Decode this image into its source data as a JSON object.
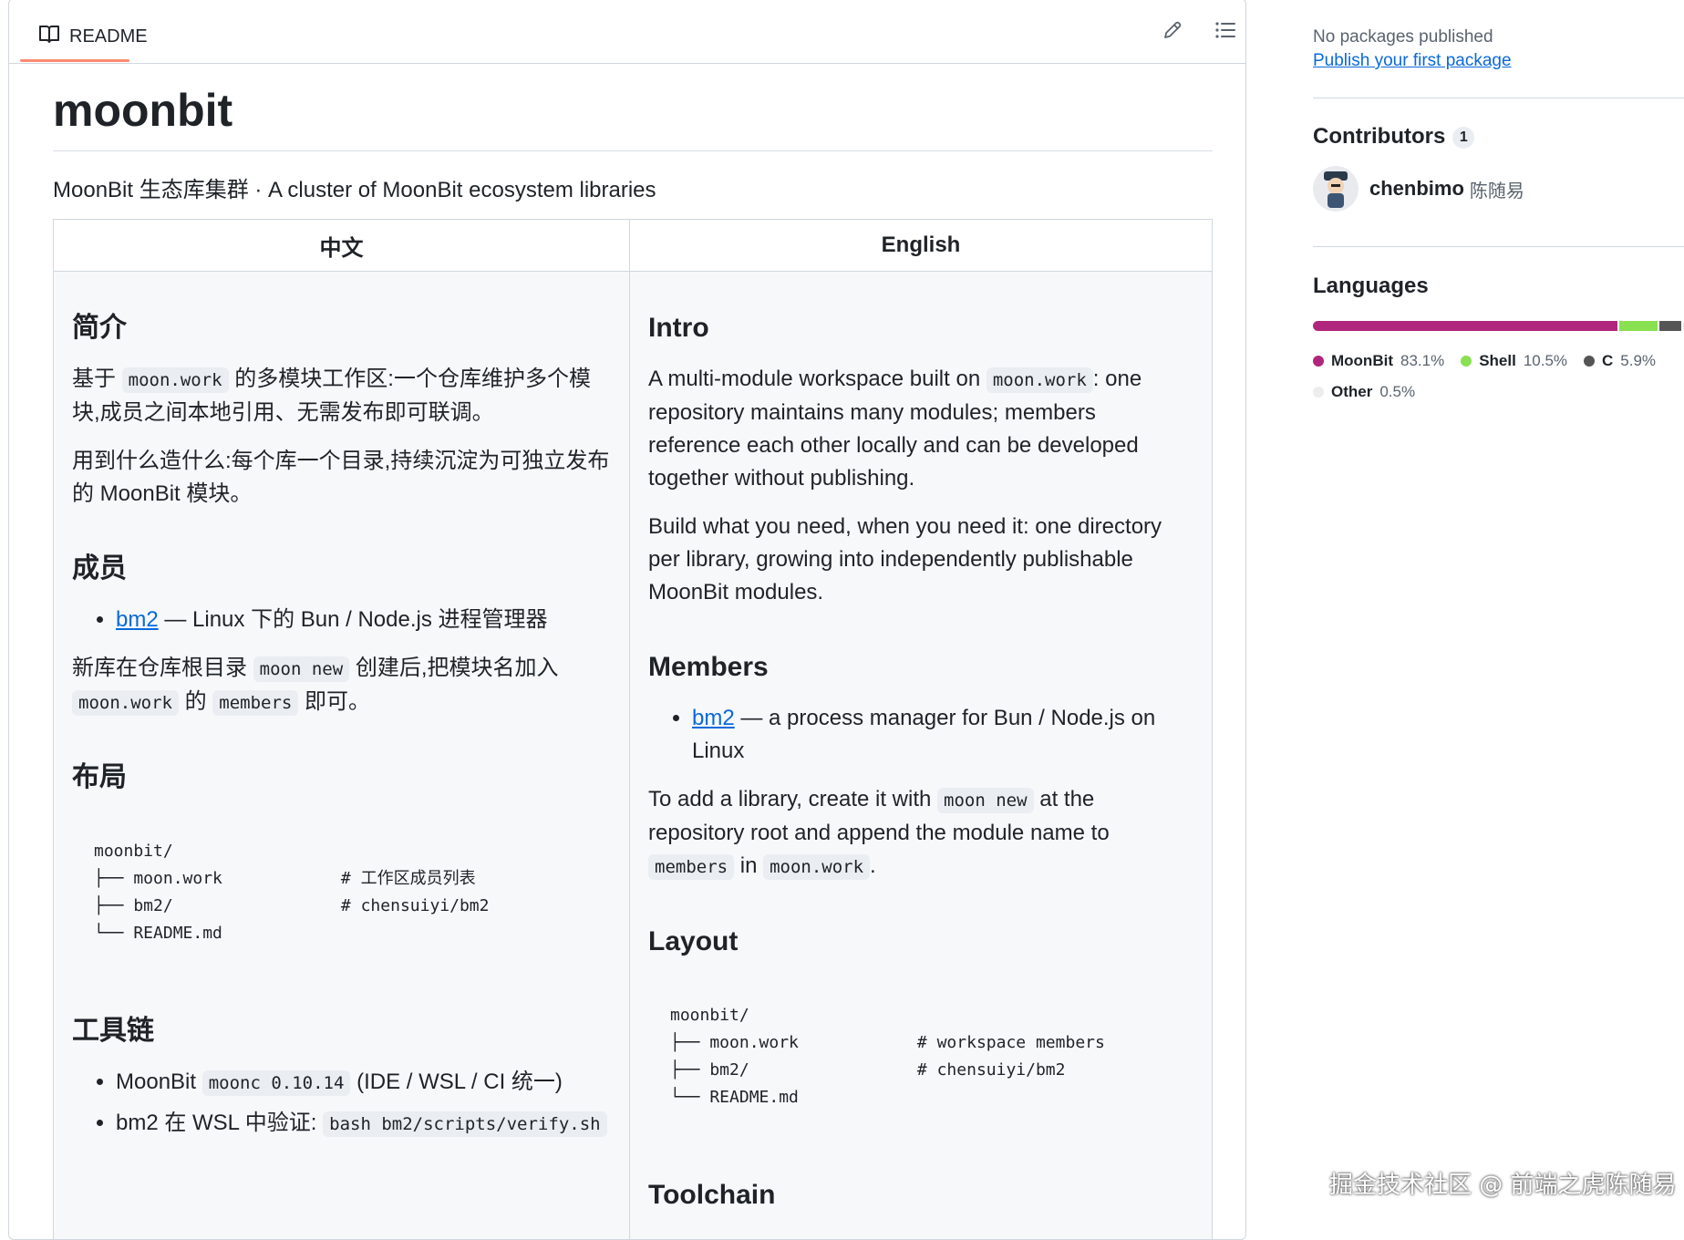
{
  "readme": {
    "tab_label": "README",
    "title": "moonbit",
    "subtitle": "MoonBit 生态库集群 · A cluster of MoonBit ecosystem libraries",
    "columns": [
      "中文",
      "English"
    ]
  },
  "zh": {
    "intro_heading": "简介",
    "intro_p1_a": "基于",
    "intro_p1_code": "moon.work",
    "intro_p1_b": "的多模块工作区:一个仓库维护多个模块,成员之间本地引用、无需发布即可联调。",
    "intro_p2": "用到什么造什么:每个库一个目录,持续沉淀为可独立发布的 MoonBit 模块。",
    "members_heading": "成员",
    "member_link": "bm2",
    "member_desc": " — Linux 下的 Bun / Node.js 进程管理器",
    "add_a": "新库在仓库根目录",
    "add_code1": "moon new",
    "add_b": "创建后,把模块名加入",
    "add_code2": "moon.work",
    "add_c": "的",
    "add_code3": "members",
    "add_d": "即可。",
    "layout_heading": "布局",
    "tree": "moonbit/\n├── moon.work            # 工作区成员列表\n├── bm2/                 # chensuiyi/bm2\n└── README.md",
    "toolchain_heading": "工具链",
    "tool1_a": "MoonBit ",
    "tool1_code": "moonc 0.10.14",
    "tool1_b": " (IDE / WSL / CI 统一)",
    "tool2_a": "bm2 在 WSL 中验证: ",
    "tool2_code": "bash bm2/scripts/verify.sh"
  },
  "en": {
    "intro_heading": "Intro",
    "intro_p1_a": "A multi-module workspace built on ",
    "intro_p1_code": "moon.work",
    "intro_p1_b": ": one repository maintains many modules; members reference each other locally and can be developed together without publishing.",
    "intro_p2": "Build what you need, when you need it: one directory per library, growing into independently publishable MoonBit modules.",
    "members_heading": "Members",
    "member_link": "bm2",
    "member_desc": " — a process manager for Bun / Node.js on Linux",
    "add_a": "To add a library, create it with ",
    "add_code1": "moon new",
    "add_b": " at the repository root and append the module name to ",
    "add_code2": "members",
    "add_c": " in ",
    "add_code3": "moon.work",
    "add_d": ".",
    "layout_heading": "Layout",
    "tree": "moonbit/\n├── moon.work            # workspace members\n├── bm2/                 # chensuiyi/bm2\n└── README.md",
    "toolchain_heading": "Toolchain"
  },
  "sidebar": {
    "packages_empty": "No packages published",
    "packages_link": "Publish your first package",
    "contributors_heading": "Contributors",
    "contributors_count": "1",
    "contributor_login": "chenbimo",
    "contributor_name": "陈随易",
    "languages_heading": "Languages",
    "languages": [
      {
        "name": "MoonBit",
        "pct": "83.1%",
        "value": 83.1,
        "color": "#b0267c"
      },
      {
        "name": "Shell",
        "pct": "10.5%",
        "value": 10.5,
        "color": "#89e051"
      },
      {
        "name": "C",
        "pct": "5.9%",
        "value": 5.9,
        "color": "#555555"
      },
      {
        "name": "Other",
        "pct": "0.5%",
        "value": 0.5,
        "color": "#ededed"
      }
    ]
  },
  "watermark": "掘金技术社区 @ 前端之虎陈随易"
}
